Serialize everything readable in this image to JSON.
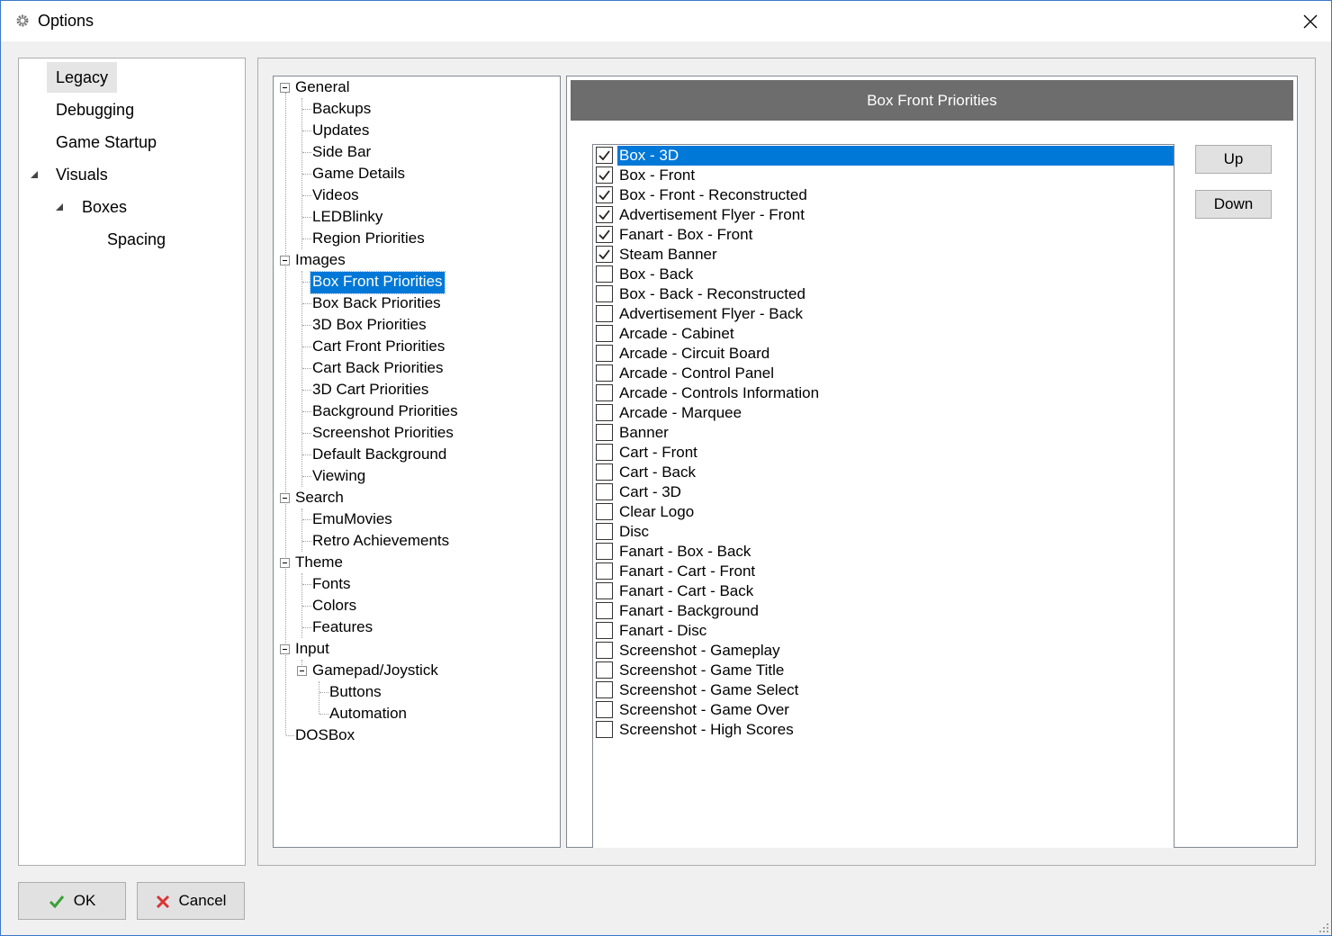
{
  "window": {
    "title": "Options"
  },
  "leftnav": {
    "items": [
      {
        "label": "Legacy"
      },
      {
        "label": "Debugging"
      },
      {
        "label": "Game Startup"
      },
      {
        "label": "Visuals"
      },
      {
        "label": "Boxes"
      },
      {
        "label": "Spacing"
      }
    ]
  },
  "tree": {
    "nodes": [
      {
        "label": "General"
      },
      {
        "label": "Backups"
      },
      {
        "label": "Updates"
      },
      {
        "label": "Side Bar"
      },
      {
        "label": "Game Details"
      },
      {
        "label": "Videos"
      },
      {
        "label": "LEDBlinky"
      },
      {
        "label": "Region Priorities"
      },
      {
        "label": "Images"
      },
      {
        "label": "Box Front Priorities"
      },
      {
        "label": "Box Back Priorities"
      },
      {
        "label": "3D Box Priorities"
      },
      {
        "label": "Cart Front Priorities"
      },
      {
        "label": "Cart Back Priorities"
      },
      {
        "label": "3D Cart Priorities"
      },
      {
        "label": "Background Priorities"
      },
      {
        "label": "Screenshot Priorities"
      },
      {
        "label": "Default Background"
      },
      {
        "label": "Viewing"
      },
      {
        "label": "Search"
      },
      {
        "label": "EmuMovies"
      },
      {
        "label": "Retro Achievements"
      },
      {
        "label": "Theme"
      },
      {
        "label": "Fonts"
      },
      {
        "label": "Colors"
      },
      {
        "label": "Features"
      },
      {
        "label": "Input"
      },
      {
        "label": "Gamepad/Joystick"
      },
      {
        "label": "Buttons"
      },
      {
        "label": "Automation"
      },
      {
        "label": "DOSBox"
      }
    ]
  },
  "content": {
    "header": "Box Front Priorities",
    "items": [
      {
        "label": "Box - 3D",
        "checked": true
      },
      {
        "label": "Box - Front",
        "checked": true
      },
      {
        "label": "Box - Front - Reconstructed",
        "checked": true
      },
      {
        "label": "Advertisement Flyer - Front",
        "checked": true
      },
      {
        "label": "Fanart - Box - Front",
        "checked": true
      },
      {
        "label": "Steam Banner",
        "checked": true
      },
      {
        "label": "Box - Back",
        "checked": false
      },
      {
        "label": "Box - Back - Reconstructed",
        "checked": false
      },
      {
        "label": "Advertisement Flyer - Back",
        "checked": false
      },
      {
        "label": "Arcade - Cabinet",
        "checked": false
      },
      {
        "label": "Arcade - Circuit Board",
        "checked": false
      },
      {
        "label": "Arcade - Control Panel",
        "checked": false
      },
      {
        "label": "Arcade - Controls Information",
        "checked": false
      },
      {
        "label": "Arcade - Marquee",
        "checked": false
      },
      {
        "label": "Banner",
        "checked": false
      },
      {
        "label": "Cart - Front",
        "checked": false
      },
      {
        "label": "Cart - Back",
        "checked": false
      },
      {
        "label": "Cart - 3D",
        "checked": false
      },
      {
        "label": "Clear Logo",
        "checked": false
      },
      {
        "label": "Disc",
        "checked": false
      },
      {
        "label": "Fanart - Box - Back",
        "checked": false
      },
      {
        "label": "Fanart - Cart - Front",
        "checked": false
      },
      {
        "label": "Fanart - Cart - Back",
        "checked": false
      },
      {
        "label": "Fanart - Background",
        "checked": false
      },
      {
        "label": "Fanart - Disc",
        "checked": false
      },
      {
        "label": "Screenshot - Gameplay",
        "checked": false
      },
      {
        "label": "Screenshot - Game Title",
        "checked": false
      },
      {
        "label": "Screenshot - Game Select",
        "checked": false
      },
      {
        "label": "Screenshot - Game Over",
        "checked": false
      },
      {
        "label": "Screenshot - High Scores",
        "checked": false
      }
    ],
    "up_label": "Up",
    "down_label": "Down"
  },
  "footer": {
    "ok_label": "OK",
    "cancel_label": "Cancel"
  },
  "colors": {
    "selection": "#0078d7",
    "header": "#6d6d6d",
    "ok_icon": "#3aa03a",
    "cancel_icon": "#d83434"
  },
  "icons": {
    "title": "gear-icon",
    "close": "close-icon",
    "ok": "check-icon",
    "cancel": "x-icon"
  }
}
